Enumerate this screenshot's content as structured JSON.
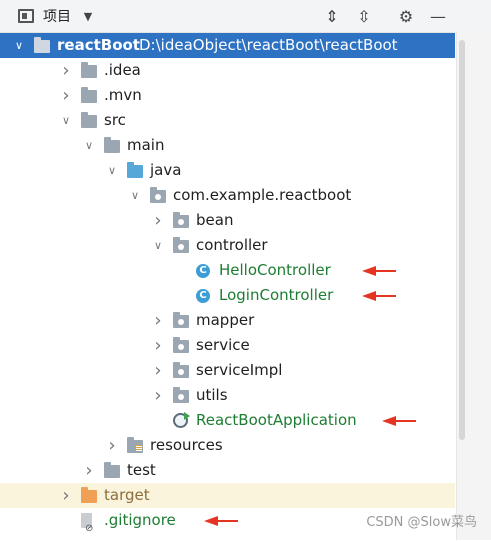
{
  "toolbar": {
    "title": "项目",
    "dropdown_glyph": "▼",
    "expand_glyph": "⇕",
    "collapse_glyph": "⇳",
    "settings_glyph": "⚙",
    "minimize_glyph": "—"
  },
  "tree": [
    {
      "id": "root",
      "label": "reactBoot",
      "path": "D:\\ideaObject\\reactBoot\\reactBoot",
      "icon": "module-folder-icon",
      "state": "expanded",
      "depth": 0,
      "selected": true
    },
    {
      "id": "idea",
      "label": ".idea",
      "icon": "folder-icon",
      "state": "collapsed",
      "depth": 1
    },
    {
      "id": "mvn",
      "label": ".mvn",
      "icon": "folder-icon",
      "state": "collapsed",
      "depth": 1
    },
    {
      "id": "src",
      "label": "src",
      "icon": "folder-icon",
      "state": "expanded",
      "depth": 1
    },
    {
      "id": "main",
      "label": "main",
      "icon": "folder-icon",
      "state": "expanded",
      "depth": 2
    },
    {
      "id": "java",
      "label": "java",
      "icon": "source-folder-icon",
      "state": "expanded",
      "depth": 3
    },
    {
      "id": "pkg",
      "label": "com.example.reactboot",
      "icon": "package-icon",
      "state": "expanded",
      "depth": 4
    },
    {
      "id": "bean",
      "label": "bean",
      "icon": "package-icon",
      "state": "collapsed",
      "depth": 5
    },
    {
      "id": "controller",
      "label": "controller",
      "icon": "package-icon",
      "state": "expanded",
      "depth": 5
    },
    {
      "id": "hello",
      "label": "HelloController",
      "icon": "class-icon",
      "state": "leaf",
      "depth": 6,
      "color": "green",
      "arrow": true
    },
    {
      "id": "login",
      "label": "LoginController",
      "icon": "class-icon",
      "state": "leaf",
      "depth": 6,
      "color": "green",
      "arrow": true
    },
    {
      "id": "mapper",
      "label": "mapper",
      "icon": "package-icon",
      "state": "collapsed",
      "depth": 5
    },
    {
      "id": "service",
      "label": "service",
      "icon": "package-icon",
      "state": "collapsed",
      "depth": 5
    },
    {
      "id": "serviceImpl",
      "label": "serviceImpl",
      "icon": "package-icon",
      "state": "collapsed",
      "depth": 5
    },
    {
      "id": "utils",
      "label": "utils",
      "icon": "package-icon",
      "state": "collapsed",
      "depth": 5
    },
    {
      "id": "app",
      "label": "ReactBootApplication",
      "icon": "spring-boot-app-icon",
      "state": "leaf",
      "depth": 5,
      "color": "green",
      "arrow": true
    },
    {
      "id": "resources",
      "label": "resources",
      "icon": "resources-folder-icon",
      "state": "collapsed",
      "depth": 3
    },
    {
      "id": "test",
      "label": "test",
      "icon": "folder-icon",
      "state": "collapsed",
      "depth": 2
    },
    {
      "id": "target",
      "label": "target",
      "icon": "excluded-folder-icon",
      "state": "collapsed",
      "depth": 1,
      "color": "brown",
      "excluded": true
    },
    {
      "id": "gitignore",
      "label": ".gitignore",
      "icon": "ignored-file-icon",
      "state": "leaf",
      "depth": 1,
      "color": "green",
      "arrow": true
    }
  ],
  "colors": {
    "selection": "#2e72c4",
    "vcs_added_green": "#1d7d32",
    "annotation_arrow": "#e53422"
  },
  "watermark": "CSDN @Slow菜鸟"
}
